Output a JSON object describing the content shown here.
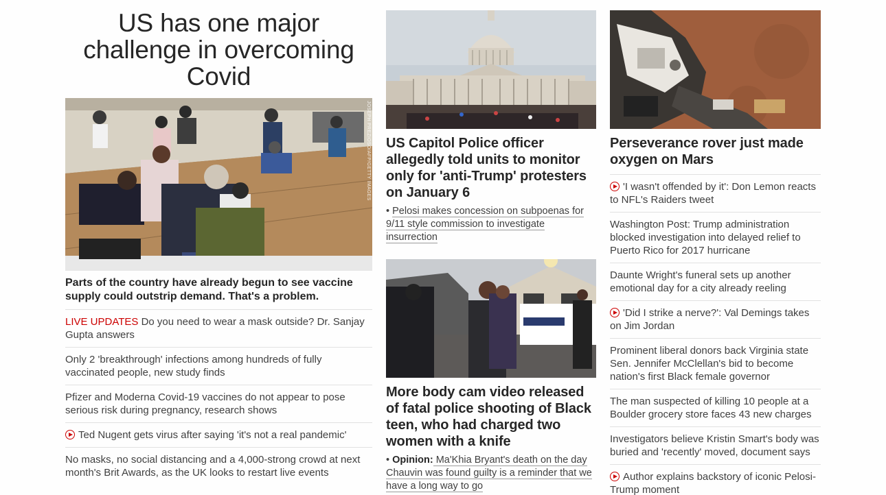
{
  "col1": {
    "headline": "US has one major challenge in overcoming Covid",
    "photo_credit": "JOSEPH PREZIOSO/AFP/GETTY IMAGES",
    "caption": "Parts of the country have already begun to see vaccine supply could outstrip demand. That's a problem.",
    "items": [
      {
        "live": "LIVE UPDATES",
        "text": " Do you need to wear a mask outside? Dr. Sanjay Gupta answers",
        "video": false
      },
      {
        "live": "",
        "text": "Only 2 'breakthrough' infections among hundreds of fully vaccinated people, new study finds",
        "video": false
      },
      {
        "live": "",
        "text": "Pfizer and Moderna Covid-19 vaccines do not appear to pose serious risk during pregnancy, research shows",
        "video": false
      },
      {
        "live": "",
        "text": "Ted Nugent gets virus after saying 'it's not a real pandemic'",
        "video": true
      },
      {
        "live": "",
        "text": "No masks, no social distancing and a 4,000-strong crowd at next month's Brit Awards, as the UK looks to restart live events",
        "video": false
      }
    ]
  },
  "col2": {
    "story1": {
      "title": "US Capitol Police officer allegedly told units to monitor only for 'anti-Trump' protesters on January 6",
      "sub_bullet": "• ",
      "sub_text": "Pelosi makes concession on subpoenas for 9/11 style commission to investigate insurrection"
    },
    "story2": {
      "title": "More body cam video released of fatal police shooting of Black teen, who had charged two women with a knife",
      "sub_bullet": "• ",
      "sub_label": "Opinion:",
      "sub_text": " Ma'Khia Bryant's death on the day Chauvin was found guilty is a reminder that we have a long way to go"
    }
  },
  "col3": {
    "title": "Perseverance rover just made oxygen on Mars",
    "items": [
      {
        "text": "'I wasn't offended by it': Don Lemon reacts to NFL's Raiders tweet",
        "video": true
      },
      {
        "text": "Washington Post: Trump administration blocked investigation into delayed relief to Puerto Rico for 2017 hurricane",
        "video": false
      },
      {
        "text": "Daunte Wright's funeral sets up another emotional day for a city already reeling",
        "video": false
      },
      {
        "text": "'Did I strike a nerve?': Val Demings takes on Jim Jordan",
        "video": true
      },
      {
        "text": "Prominent liberal donors back Virginia state Sen. Jennifer McClellan's bid to become nation's first Black female governor",
        "video": false
      },
      {
        "text": "The man suspected of killing 10 people at a Boulder grocery store faces 43 new charges",
        "video": false
      },
      {
        "text": "Investigators believe Kristin Smart's body was buried and 'recently' moved, document says",
        "video": false
      },
      {
        "text": "Author explains backstory of iconic Pelosi-Trump moment",
        "video": true
      }
    ]
  },
  "colors": {
    "live": "#cc0000",
    "text": "#262626",
    "divider": "#e1e1e1"
  }
}
